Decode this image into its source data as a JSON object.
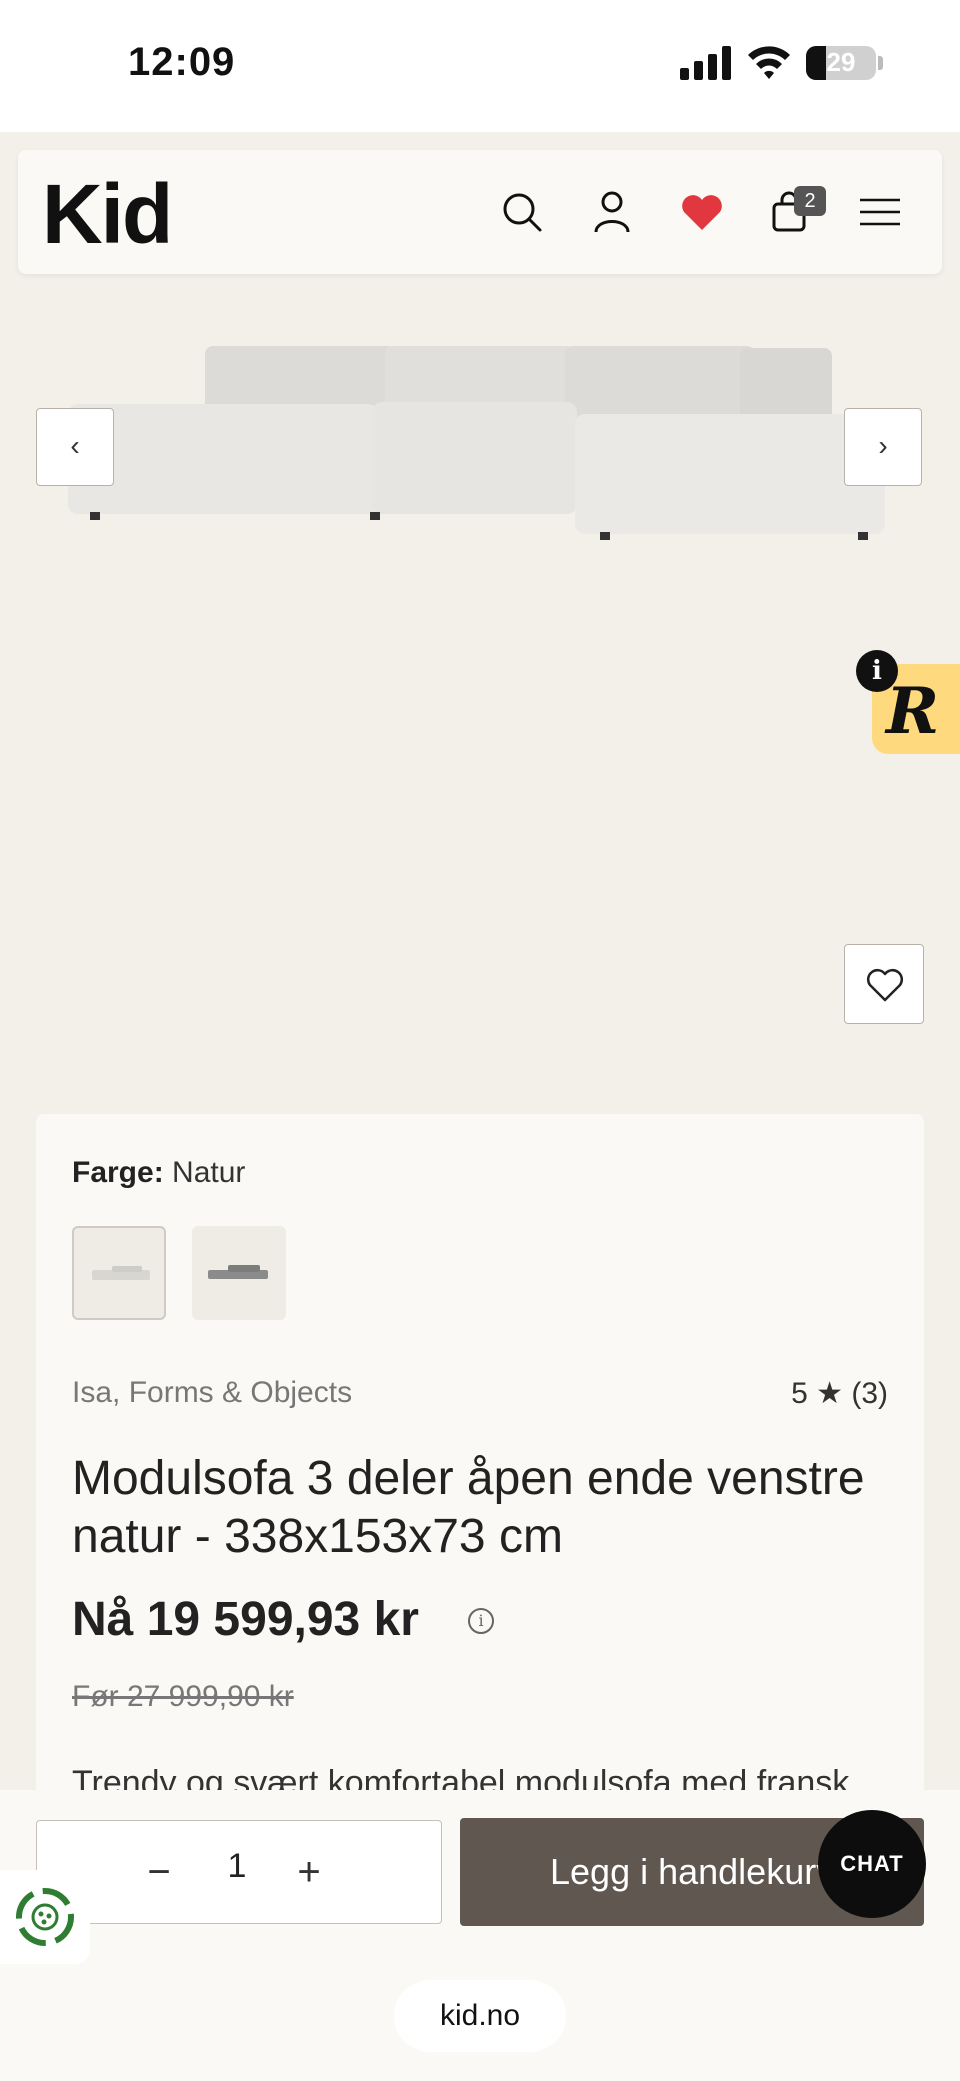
{
  "status": {
    "time": "12:09",
    "battery": "29"
  },
  "header": {
    "logo": "Kid",
    "cart_count": "2",
    "icons": [
      "search-icon",
      "account-icon",
      "heart-filled-icon",
      "cart-icon",
      "menu-icon"
    ]
  },
  "gallery": {
    "prev_label": "‹",
    "next_label": "›",
    "product_image": "sofa-image"
  },
  "badge": {
    "letter": "R",
    "info": "i"
  },
  "product": {
    "color_label": "Farge:",
    "color_value": "Natur",
    "brand": "Isa, Forms & Objects",
    "rating": "5 ★ (3)",
    "title": "Modulsofa 3 deler åpen ende venstre natur - 338x153x73 cm",
    "price": "Nå 19 599,93 kr",
    "old_price": "Før 27 999,90 kr",
    "description": "Trendy og svært komfortabel modulsofa med fransk"
  },
  "cart_bar": {
    "minus": "−",
    "quantity": "1",
    "plus": "+",
    "add_label": "Legg i handlekurv",
    "chat_label": "CHAT"
  },
  "browser": {
    "url": "kid.no"
  },
  "colors": {
    "accent": "#5f5750",
    "heart": "#e0383e",
    "badge": "#ffd97d",
    "background": "#f3f0ea"
  }
}
